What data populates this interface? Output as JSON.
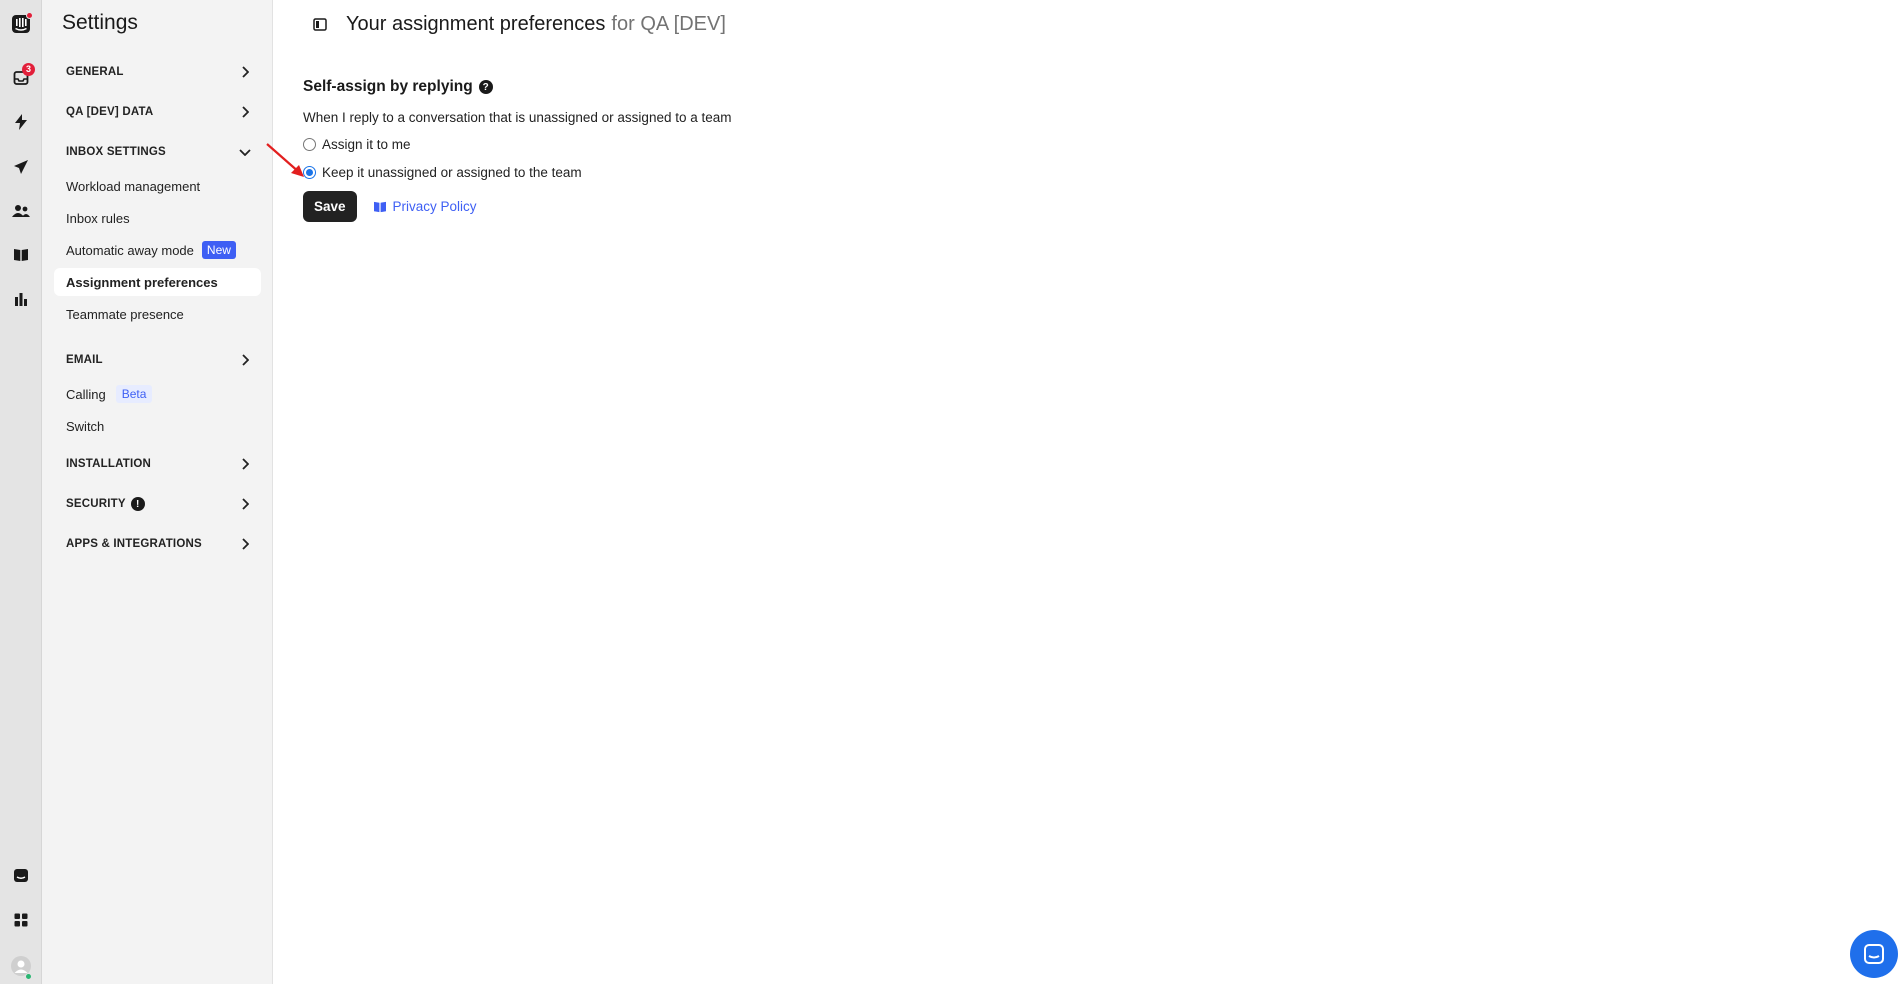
{
  "sidebar": {
    "title": "Settings",
    "sections": {
      "general": "GENERAL",
      "qa_data": "QA [DEV] DATA",
      "inbox_settings": "INBOX SETTINGS",
      "email": "EMAIL",
      "installation": "INSTALLATION",
      "security": "SECURITY",
      "apps": "APPS & INTEGRATIONS"
    },
    "items": {
      "workload": "Workload management",
      "inbox_rules": "Inbox rules",
      "away_mode": "Automatic away mode",
      "away_mode_badge": "New",
      "assignment_prefs": "Assignment preferences",
      "presence": "Teammate presence",
      "calling": "Calling",
      "calling_badge": "Beta",
      "switch": "Switch"
    }
  },
  "rail": {
    "inbox_badge": "3",
    "icons": [
      "intercom-logo-icon",
      "inbox-icon",
      "bolt-icon",
      "paper-plane-icon",
      "contacts-icon",
      "book-icon",
      "reports-icon",
      "conversation-icon",
      "apps-grid-icon",
      "user-avatar-icon"
    ]
  },
  "header": {
    "title": "Your assignment preferences",
    "suffix": "for QA [DEV]"
  },
  "main": {
    "section_heading": "Self-assign by replying",
    "description": "When I reply to a conversation that is unassigned or assigned to a team",
    "options": [
      {
        "label": "Assign it to me",
        "checked": false
      },
      {
        "label": "Keep it unassigned or assigned to the team",
        "checked": true
      }
    ],
    "save_label": "Save",
    "privacy_link": "Privacy Policy"
  },
  "colors": {
    "accent": "#3e5ff4",
    "radio_checked": "#1a73e8",
    "badge_red": "#e21f3a",
    "annotation_arrow": "#e21f1f"
  }
}
